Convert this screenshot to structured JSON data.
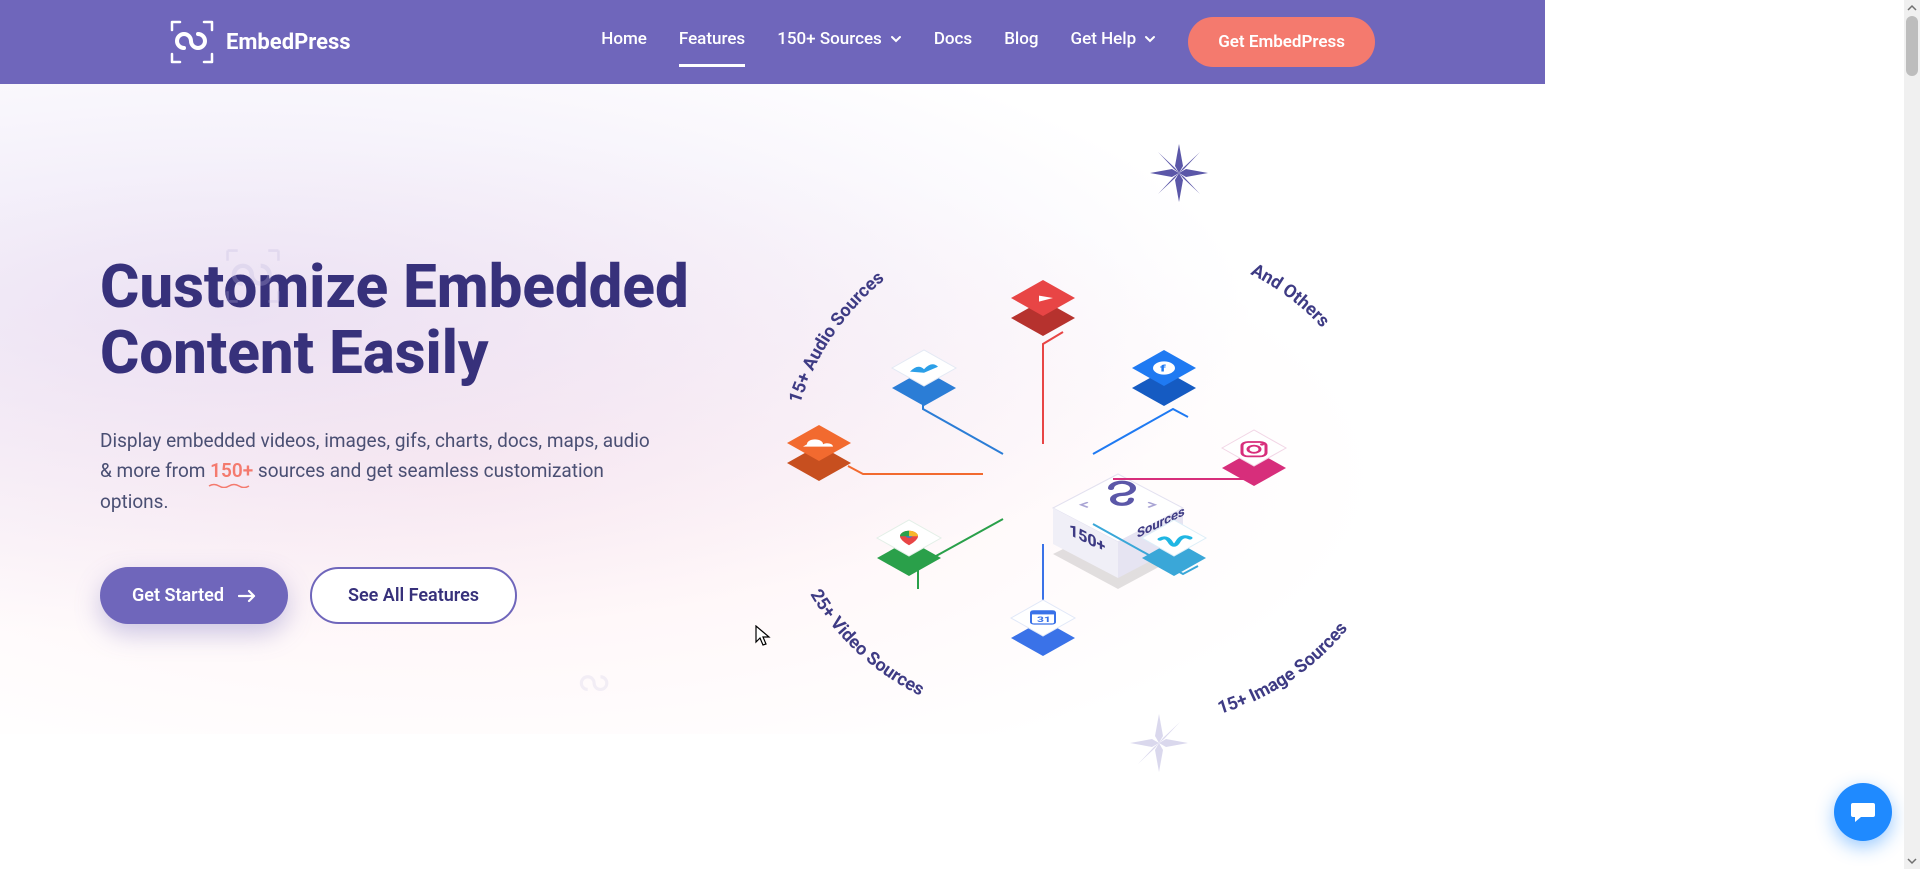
{
  "brand": {
    "name": "EmbedPress"
  },
  "nav": {
    "items": [
      {
        "label": "Home"
      },
      {
        "label": "Features",
        "active": true
      },
      {
        "label": "150+ Sources",
        "dropdown": true
      },
      {
        "label": "Docs"
      },
      {
        "label": "Blog"
      },
      {
        "label": "Get Help",
        "dropdown": true
      }
    ],
    "cta": "Get EmbedPress"
  },
  "hero": {
    "title_line1": "Customize Embedded",
    "title_line2": "Content Easily",
    "desc_pre": "Display embedded videos, images, gifs, charts, docs, maps, audio & more from ",
    "desc_highlight": "150+",
    "desc_post": " sources and get seamless customization options.",
    "btn_primary": "Get Started",
    "btn_secondary": "See All Features"
  },
  "illustration": {
    "labels": {
      "audio": "15+ Audio Sources",
      "others": "And Others",
      "video": "25+ Video Sources",
      "image": "15+ Image Sources"
    },
    "center_top": "150+",
    "center_front": "Sources",
    "tiles": {
      "youtube": {
        "name": "youtube-icon",
        "fill": "#e84545",
        "glyph": "youtube"
      },
      "twitter": {
        "name": "twitter-icon",
        "fill": "#ffffff",
        "glyph": "wings",
        "shadow": "#2b7dd6"
      },
      "facebook": {
        "name": "facebook-icon",
        "fill": "#1f7af2",
        "glyph": "f"
      },
      "soundcloud": {
        "name": "soundcloud-icon",
        "fill": "#f26a2f",
        "glyph": "cloud"
      },
      "instagram": {
        "name": "instagram-icon",
        "fill": "#ffffff",
        "glyph": "instagram",
        "shadow": "#d72e7b"
      },
      "gmaps": {
        "name": "gmaps-icon",
        "fill": "#ffffff",
        "glyph": "pin",
        "shadow": "#2aa04a"
      },
      "vimeo": {
        "name": "vimeo-icon",
        "fill": "#ffffff",
        "glyph": "vimeo",
        "shadow": "#3aa7d8"
      },
      "gcal": {
        "name": "gcal-icon",
        "fill": "#ffffff",
        "glyph": "calendar",
        "shadow": "#3a72e8"
      }
    }
  },
  "colors": {
    "brandPurple": "#6f66bb",
    "deepPurple": "#37317b",
    "coral": "#f47a6e",
    "blue": "#1f8aff"
  }
}
